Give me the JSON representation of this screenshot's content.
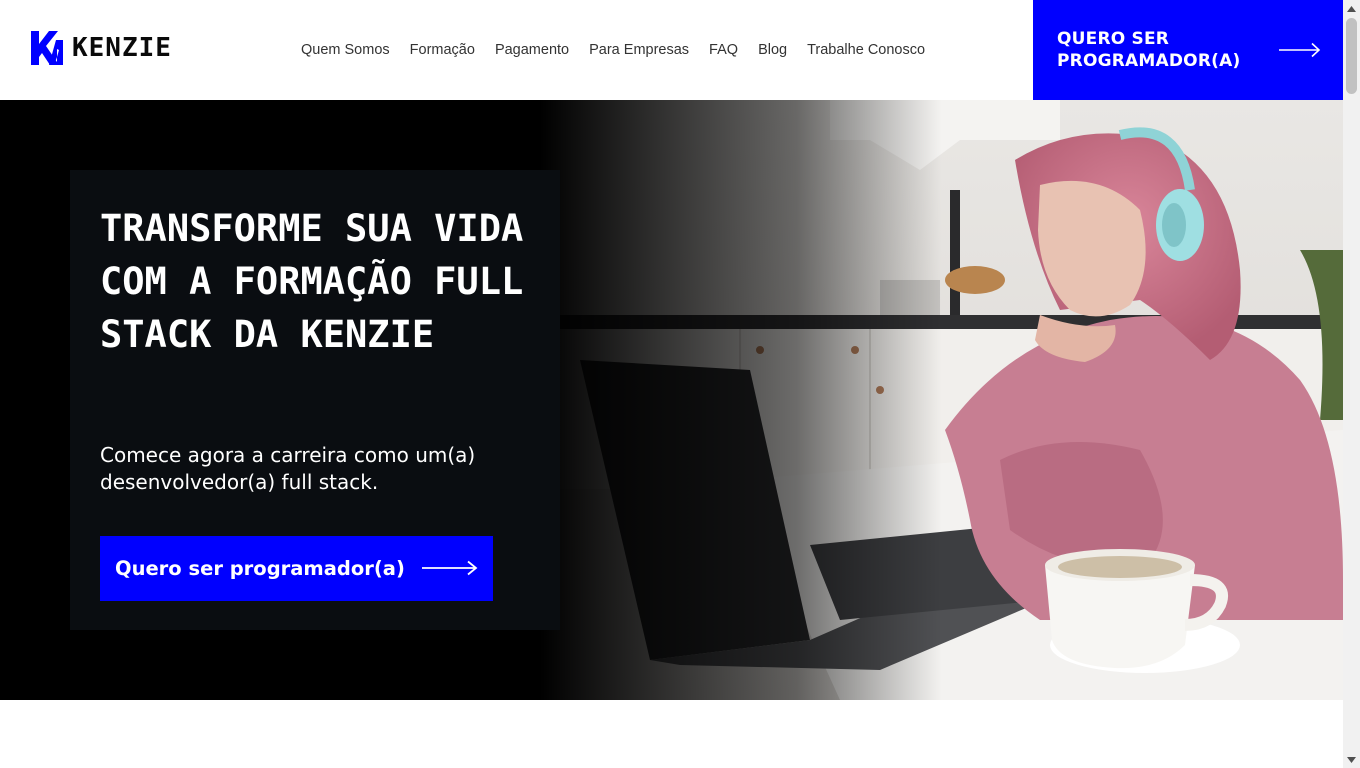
{
  "header": {
    "logo_text": "KENZIE",
    "nav": [
      "Quem Somos",
      "Formação",
      "Pagamento",
      "Para Empresas",
      "FAQ",
      "Blog",
      "Trabalhe Conosco"
    ],
    "cta_label": "QUERO SER PROGRAMADOR(A)"
  },
  "hero": {
    "title": "TRANSFORME SUA VIDA COM A FORMAÇÃO FULL STACK DA KENZIE",
    "subtitle": "Comece agora a carreira como um(a) desenvolvedor(a) full stack.",
    "button_label": "Quero ser programador(a)",
    "image_desc": "woman-with-headphones-at-laptop"
  },
  "colors": {
    "brand_blue": "#0000ff",
    "hero_bg": "#000000",
    "card_bg": "#0a0d11",
    "text_dark": "#333333"
  },
  "icons": {
    "arrow": "arrow-right-icon",
    "logo": "kenzie-logo-icon"
  }
}
